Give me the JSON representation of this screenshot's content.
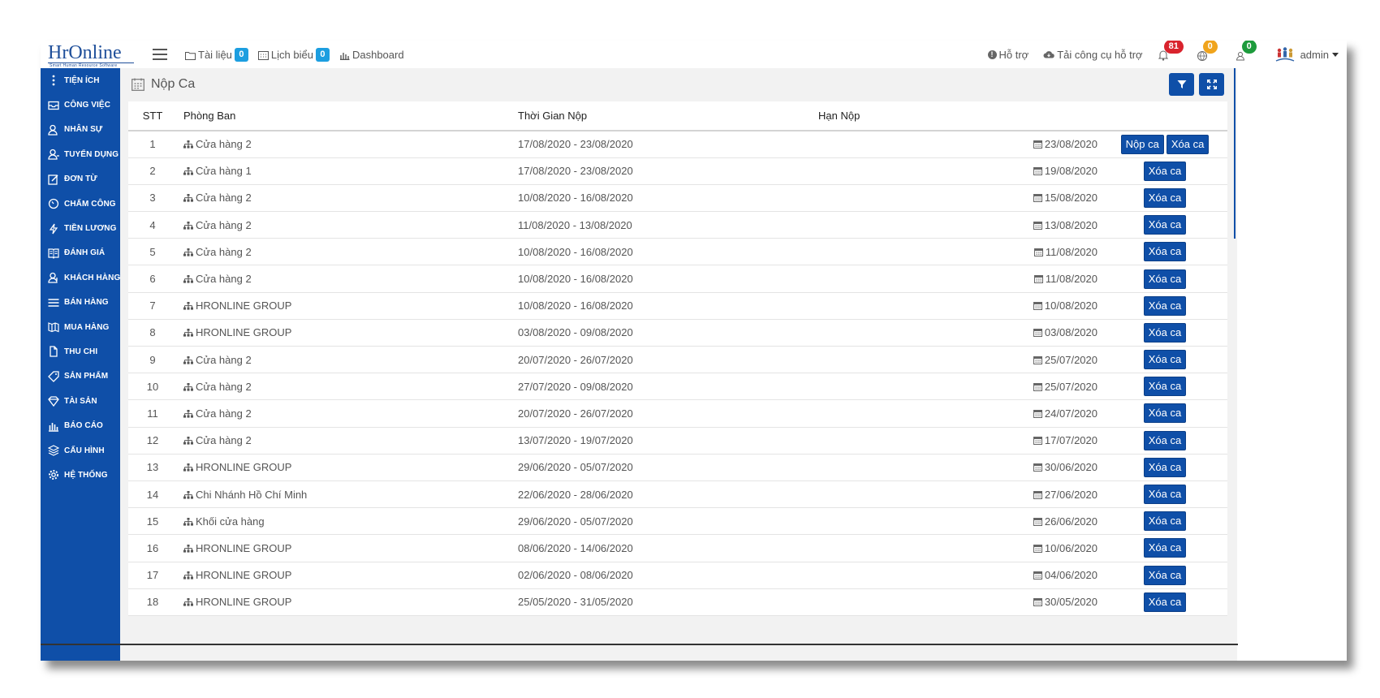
{
  "app": {
    "logo": "HrOnline",
    "logo_sub": "Smart Human Resource Software"
  },
  "topnav": {
    "items": [
      {
        "label": "Tài liệu",
        "icon": "folder-icon",
        "badge": "0"
      },
      {
        "label": "Lịch biểu",
        "icon": "calendar-icon",
        "badge": "0"
      },
      {
        "label": "Dashboard",
        "icon": "bar-chart-icon",
        "badge": null
      }
    ],
    "help_label": "Hỗ trợ",
    "download_label": "Tải công cụ hỗ trợ",
    "notifications": [
      {
        "icon": "bell-icon",
        "count": "81",
        "color": "#d9232d"
      },
      {
        "icon": "globe-icon",
        "count": "0",
        "color": "#f0a41c"
      },
      {
        "icon": "people-icon",
        "count": "0",
        "color": "#1d9b3c"
      }
    ],
    "user": "admin"
  },
  "sidebar": {
    "items": [
      {
        "label": "TIỆN ÍCH",
        "icon": "dots-vertical-icon"
      },
      {
        "label": "CÔNG VIỆC",
        "icon": "inbox-icon"
      },
      {
        "label": "NHÂN SỰ",
        "icon": "person-icon"
      },
      {
        "label": "TUYỂN DỤNG",
        "icon": "person-add-icon"
      },
      {
        "label": "ĐƠN TỪ",
        "icon": "edit-icon"
      },
      {
        "label": "CHẤM CÔNG",
        "icon": "clock-icon"
      },
      {
        "label": "TIỀN LƯƠNG",
        "icon": "bolt-icon"
      },
      {
        "label": "ĐÁNH GIÁ",
        "icon": "book-icon"
      },
      {
        "label": "KHÁCH HÀNG",
        "icon": "customer-icon"
      },
      {
        "label": "BÁN HÀNG",
        "icon": "menu-lines-icon"
      },
      {
        "label": "MUA HÀNG",
        "icon": "map-icon"
      },
      {
        "label": "THU CHI",
        "icon": "file-icon"
      },
      {
        "label": "SẢN PHẨM",
        "icon": "tag-icon"
      },
      {
        "label": "TÀI SẢN",
        "icon": "diamond-icon"
      },
      {
        "label": "BÁO CÁO",
        "icon": "report-icon"
      },
      {
        "label": "CẤU HÌNH",
        "icon": "layers-icon"
      },
      {
        "label": "HỆ THỐNG",
        "icon": "gear-icon"
      }
    ]
  },
  "page": {
    "title": "Nộp Ca",
    "filter_icon": "filter-icon",
    "expand_icon": "expand-icon"
  },
  "table": {
    "headers": {
      "stt": "STT",
      "phong_ban": "Phòng Ban",
      "thoi_gian": "Thời Gian Nộp",
      "han_nop": "Hạn Nộp"
    },
    "action_nop": "Nộp ca",
    "action_xoa": "Xóa ca",
    "rows": [
      {
        "stt": "1",
        "phong_ban": "Cửa hàng 2",
        "thoi_gian": "17/08/2020 - 23/08/2020",
        "han_nop": "23/08/2020",
        "nop": true
      },
      {
        "stt": "2",
        "phong_ban": "Cửa hàng 1",
        "thoi_gian": "17/08/2020 - 23/08/2020",
        "han_nop": "19/08/2020",
        "nop": false
      },
      {
        "stt": "3",
        "phong_ban": "Cửa hàng 2",
        "thoi_gian": "10/08/2020 - 16/08/2020",
        "han_nop": "15/08/2020",
        "nop": false
      },
      {
        "stt": "4",
        "phong_ban": "Cửa hàng 2",
        "thoi_gian": "11/08/2020 - 13/08/2020",
        "han_nop": "13/08/2020",
        "nop": false
      },
      {
        "stt": "5",
        "phong_ban": "Cửa hàng 2",
        "thoi_gian": "10/08/2020 - 16/08/2020",
        "han_nop": "11/08/2020",
        "nop": false
      },
      {
        "stt": "6",
        "phong_ban": "Cửa hàng 2",
        "thoi_gian": "10/08/2020 - 16/08/2020",
        "han_nop": "11/08/2020",
        "nop": false
      },
      {
        "stt": "7",
        "phong_ban": "HRONLINE GROUP",
        "thoi_gian": "10/08/2020 - 16/08/2020",
        "han_nop": "10/08/2020",
        "nop": false
      },
      {
        "stt": "8",
        "phong_ban": "HRONLINE GROUP",
        "thoi_gian": "03/08/2020 - 09/08/2020",
        "han_nop": "03/08/2020",
        "nop": false
      },
      {
        "stt": "9",
        "phong_ban": "Cửa hàng 2",
        "thoi_gian": "20/07/2020 - 26/07/2020",
        "han_nop": "25/07/2020",
        "nop": false
      },
      {
        "stt": "10",
        "phong_ban": "Cửa hàng 2",
        "thoi_gian": "27/07/2020 - 09/08/2020",
        "han_nop": "25/07/2020",
        "nop": false
      },
      {
        "stt": "11",
        "phong_ban": "Cửa hàng 2",
        "thoi_gian": "20/07/2020 - 26/07/2020",
        "han_nop": "24/07/2020",
        "nop": false
      },
      {
        "stt": "12",
        "phong_ban": "Cửa hàng 2",
        "thoi_gian": "13/07/2020 - 19/07/2020",
        "han_nop": "17/07/2020",
        "nop": false
      },
      {
        "stt": "13",
        "phong_ban": "HRONLINE GROUP",
        "thoi_gian": "29/06/2020 - 05/07/2020",
        "han_nop": "30/06/2020",
        "nop": false
      },
      {
        "stt": "14",
        "phong_ban": "Chi Nhánh Hồ Chí Minh",
        "thoi_gian": "22/06/2020 - 28/06/2020",
        "han_nop": "27/06/2020",
        "nop": false
      },
      {
        "stt": "15",
        "phong_ban": "Khối cửa hàng",
        "thoi_gian": "29/06/2020 - 05/07/2020",
        "han_nop": "26/06/2020",
        "nop": false
      },
      {
        "stt": "16",
        "phong_ban": "HRONLINE GROUP",
        "thoi_gian": "08/06/2020 - 14/06/2020",
        "han_nop": "10/06/2020",
        "nop": false
      },
      {
        "stt": "17",
        "phong_ban": "HRONLINE GROUP",
        "thoi_gian": "02/06/2020 - 08/06/2020",
        "han_nop": "04/06/2020",
        "nop": false
      },
      {
        "stt": "18",
        "phong_ban": "HRONLINE GROUP",
        "thoi_gian": "25/05/2020 - 31/05/2020",
        "han_nop": "30/05/2020",
        "nop": false
      }
    ]
  }
}
